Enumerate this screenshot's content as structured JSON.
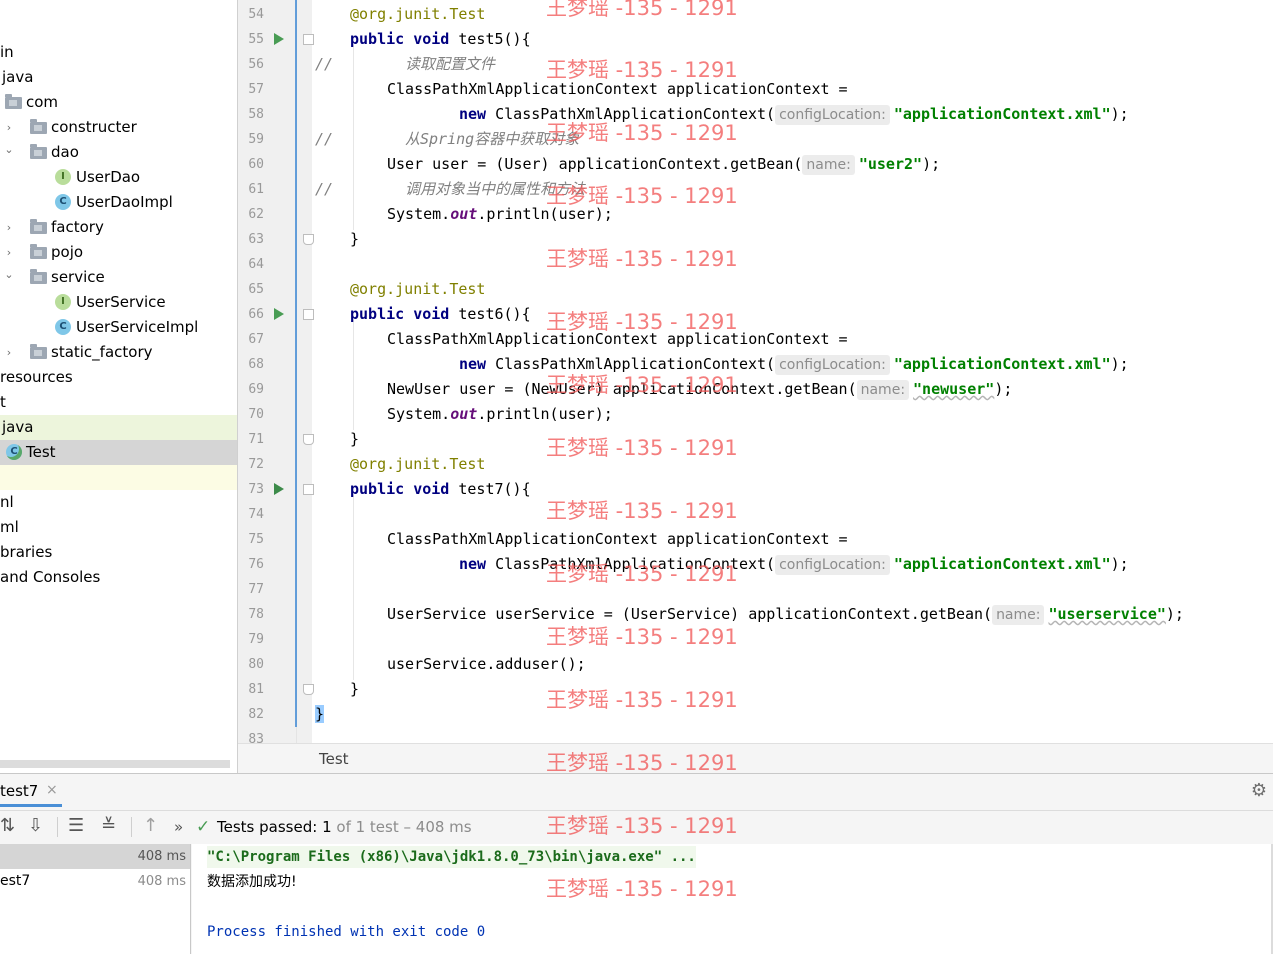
{
  "tree": {
    "items": [
      {
        "label": "in",
        "kind": "text"
      },
      {
        "label": "java",
        "kind": "text"
      },
      {
        "label": "com",
        "kind": "folder"
      },
      {
        "label": "constructer",
        "kind": "folder",
        "arrow": "›"
      },
      {
        "label": "dao",
        "kind": "folder",
        "arrow": "⌄"
      },
      {
        "label": "UserDao",
        "kind": "interface",
        "badge": "I"
      },
      {
        "label": "UserDaoImpl",
        "kind": "class",
        "badge": "C"
      },
      {
        "label": "factory",
        "kind": "folder",
        "arrow": "›"
      },
      {
        "label": "pojo",
        "kind": "folder",
        "arrow": "›"
      },
      {
        "label": "service",
        "kind": "folder",
        "arrow": "⌄"
      },
      {
        "label": "UserService",
        "kind": "interface",
        "badge": "I"
      },
      {
        "label": "UserServiceImpl",
        "kind": "class",
        "badge": "C"
      },
      {
        "label": "static_factory",
        "kind": "folder",
        "arrow": "›"
      },
      {
        "label": "resources",
        "kind": "text"
      },
      {
        "label": "t",
        "kind": "text"
      },
      {
        "label": "java",
        "kind": "text"
      },
      {
        "label": "Test",
        "kind": "test",
        "badge": "C"
      },
      {
        "label": "",
        "kind": "text"
      },
      {
        "label": "nl",
        "kind": "text"
      },
      {
        "label": "ml",
        "kind": "text"
      },
      {
        "label": "braries",
        "kind": "text"
      },
      {
        "label": "and Consoles",
        "kind": "text"
      }
    ]
  },
  "editor": {
    "line_numbers": [
      "54",
      "55",
      "56",
      "57",
      "58",
      "59",
      "60",
      "61",
      "62",
      "63",
      "64",
      "65",
      "66",
      "67",
      "68",
      "69",
      "70",
      "71",
      "72",
      "73",
      "74",
      "75",
      "76",
      "77",
      "78",
      "79",
      "80",
      "81",
      "82",
      "83"
    ],
    "code": {
      "l54_ann": "@org.junit.",
      "l54_cls": "Test",
      "l55_kw1": "public",
      "l55_kw2": "void",
      "l55_rest": "test5(){",
      "l56_slash": "//",
      "l56_cmt": "读取配置文件",
      "l57": "ClassPathXmlApplicationContext applicationContext =",
      "l58_new": "new",
      "l58_rest": "ClassPathXmlApplicationContext(",
      "l58_hint": "configLocation:",
      "l58_str": "\"applicationContext.xml\"",
      "l58_end": ");",
      "l59_slash": "//",
      "l59_cmt": "从Spring容器中获取对象",
      "l60_pre": "User user = (User) applicationContext.getBean(",
      "l60_hint": "name:",
      "l60_str": "\"user2\"",
      "l60_end": ");",
      "l61_slash": "//",
      "l61_cmt": "调用对象当中的属性和方法",
      "l62_pre": "System.",
      "l62_fld": "out",
      "l62_post": ".println(user);",
      "l63": "}",
      "l65_ann": "@org.junit.",
      "l65_cls": "Test",
      "l66_kw1": "public",
      "l66_kw2": "void",
      "l66_rest": "test6(){",
      "l67": "ClassPathXmlApplicationContext applicationContext =",
      "l68_new": "new",
      "l68_rest": "ClassPathXmlApplicationContext(",
      "l68_hint": "configLocation:",
      "l68_str": "\"applicationContext.xml\"",
      "l68_end": ");",
      "l69_pre": "NewUser user = (NewUser) applicationContext.getBean(",
      "l69_hint": "name:",
      "l69_str": "\"newuser\"",
      "l69_end": ");",
      "l70_pre": "System.",
      "l70_fld": "out",
      "l70_post": ".println(user);",
      "l71": "}",
      "l72_ann": "@org.junit.",
      "l72_cls": "Test",
      "l73_kw1": "public",
      "l73_kw2": "void",
      "l73_rest": "test7(){",
      "l75": "ClassPathXmlApplicationContext applicationContext =",
      "l76_new": "new",
      "l76_rest": "ClassPathXmlApplicationContext(",
      "l76_hint": "configLocation:",
      "l76_str": "\"applicationContext.xml\"",
      "l76_end": ");",
      "l78_pre": "UserService userService = (UserService) applicationContext.getBean(",
      "l78_hint": "name:",
      "l78_str": "\"userservice\"",
      "l78_end": ");",
      "l80": "userService.adduser();",
      "l81": "}",
      "l82": "}"
    },
    "breadcrumb": "Test"
  },
  "run": {
    "tab_label": "test7",
    "tab_close": "×",
    "status_prefix": "Tests passed:",
    "status_count": "1",
    "status_suffix": "of 1 test – 408 ms",
    "tree": [
      {
        "name": "",
        "time": "408 ms"
      },
      {
        "name": "est7",
        "time": "408 ms"
      }
    ],
    "console": {
      "cmd": "\"C:\\Program Files (x86)\\Java\\jdk1.8.0_73\\bin\\java.exe\" ...",
      "output": "数据添加成功!",
      "exit": "Process finished with exit code 0"
    }
  },
  "watermark": "王梦瑶 -135 - 1291",
  "colors": {
    "keyword": "#000080",
    "string": "#008000",
    "annotation": "#808000",
    "comment": "#808080",
    "pass": "#499c54",
    "watermark": "#f15a5a"
  }
}
